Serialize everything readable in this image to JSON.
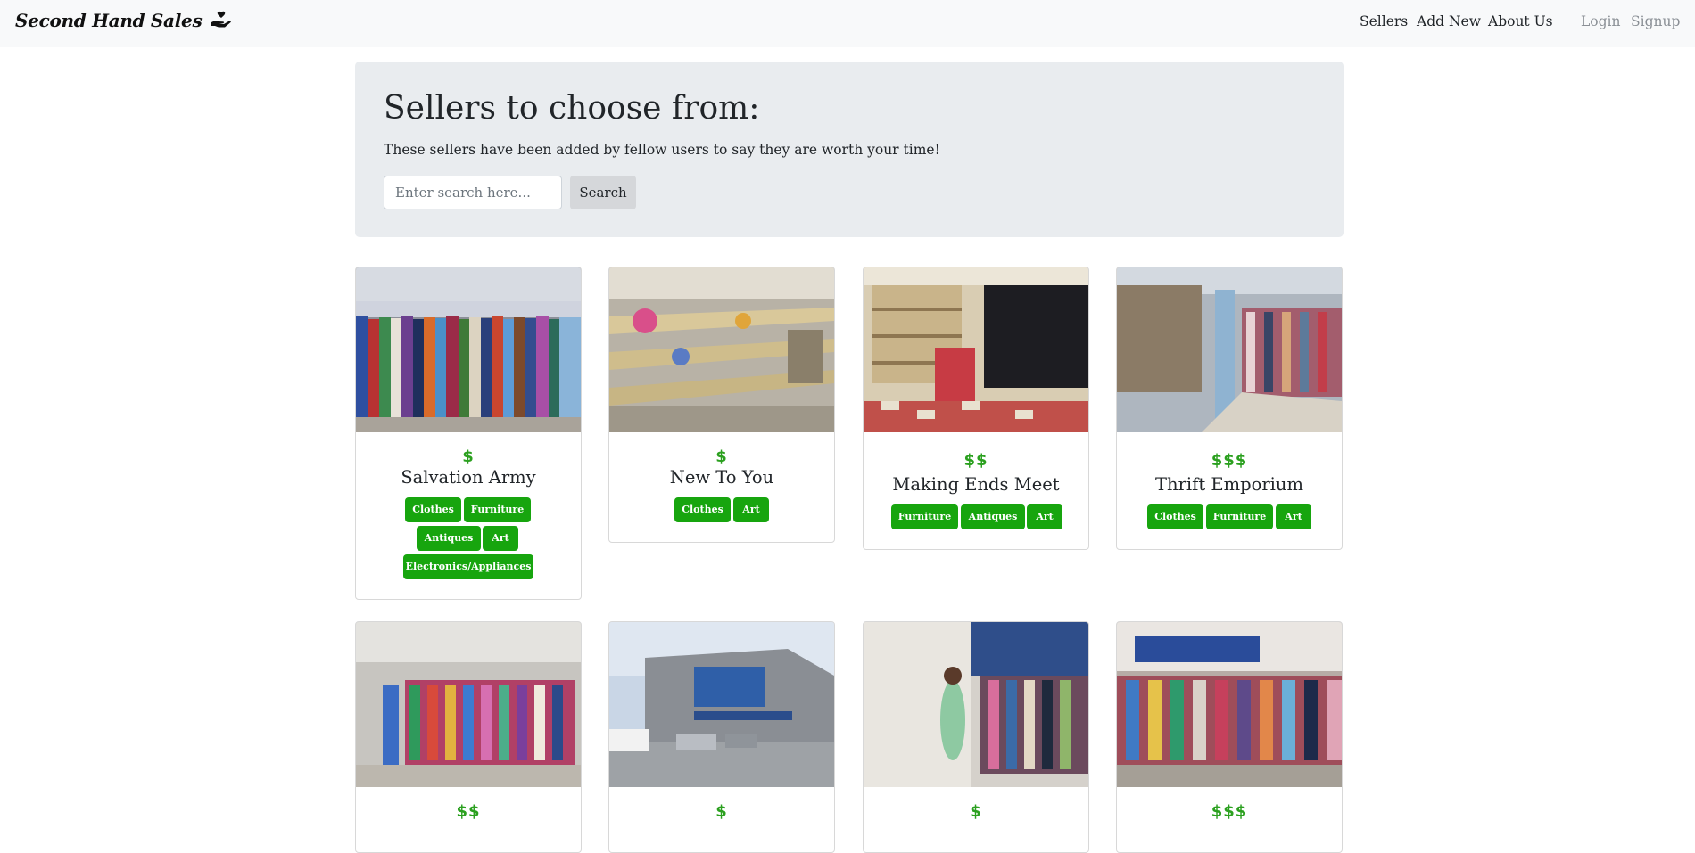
{
  "nav": {
    "brand": "Second Hand Sales",
    "links": [
      "Sellers",
      "Add New",
      "About Us"
    ],
    "auth": [
      "Login",
      "Signup"
    ]
  },
  "hero": {
    "title": "Sellers to choose from:",
    "lead": "These sellers have been added by fellow users to say they are worth your time!",
    "search_placeholder": "Enter search here...",
    "search_button": "Search"
  },
  "sellers": [
    {
      "name": "Salvation Army",
      "price": "$",
      "tags": [
        "Clothes",
        "Furniture",
        "Antiques",
        "Art",
        "Electronics/Appliances"
      ]
    },
    {
      "name": "New To You",
      "price": "$",
      "tags": [
        "Clothes",
        "Art"
      ]
    },
    {
      "name": "Making Ends Meet",
      "price": "$$",
      "tags": [
        "Furniture",
        "Antiques",
        "Art"
      ]
    },
    {
      "name": "Thrift Emporium",
      "price": "$$$",
      "tags": [
        "Clothes",
        "Furniture",
        "Art"
      ]
    },
    {
      "name": "",
      "price": "$$",
      "tags": []
    },
    {
      "name": "",
      "price": "$",
      "tags": []
    },
    {
      "name": "",
      "price": "$",
      "tags": []
    },
    {
      "name": "",
      "price": "$$$",
      "tags": []
    }
  ],
  "colors": {
    "accent_green": "#2ba01f",
    "tag_green": "#17a50e",
    "jumbotron_bg": "#e9ecef",
    "navbar_bg": "#f8f9fa"
  }
}
